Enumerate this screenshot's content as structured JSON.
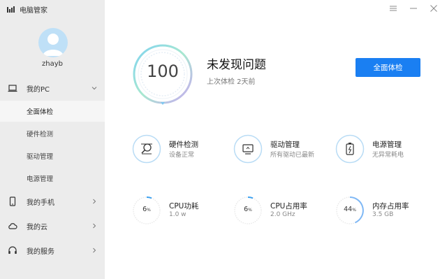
{
  "app": {
    "title": "电脑管家"
  },
  "user": {
    "name": "zhayb"
  },
  "sidebar": {
    "items": [
      {
        "label": "我的PC"
      },
      {
        "label": "我的手机"
      },
      {
        "label": "我的云"
      },
      {
        "label": "我的服务"
      }
    ],
    "sub_items": [
      {
        "label": "全面体检"
      },
      {
        "label": "硬件检测"
      },
      {
        "label": "驱动管理"
      },
      {
        "label": "电源管理"
      }
    ]
  },
  "main": {
    "score": "100",
    "status_title": "未发现问题",
    "last_check": "上次体检 2天前",
    "scan_button": "全面体检",
    "features": [
      {
        "name": "硬件检测",
        "sub": "设备正常",
        "icon": "hardware-search-icon"
      },
      {
        "name": "驱动管理",
        "sub": "所有驱动已最新",
        "icon": "driver-icon"
      },
      {
        "name": "电源管理",
        "sub": "无异常耗电",
        "icon": "battery-icon"
      }
    ],
    "metrics": [
      {
        "name": "CPU功耗",
        "sub": "1.0 w",
        "value": "6",
        "unit": "%"
      },
      {
        "name": "CPU占用率",
        "sub": "2.0 GHz",
        "value": "6",
        "unit": "%"
      },
      {
        "name": "内存占用率",
        "sub": "3.5 GB",
        "value": "44",
        "unit": "%"
      }
    ]
  },
  "colors": {
    "accent": "#1a7ff2",
    "sidebar_bg": "#ececec"
  }
}
